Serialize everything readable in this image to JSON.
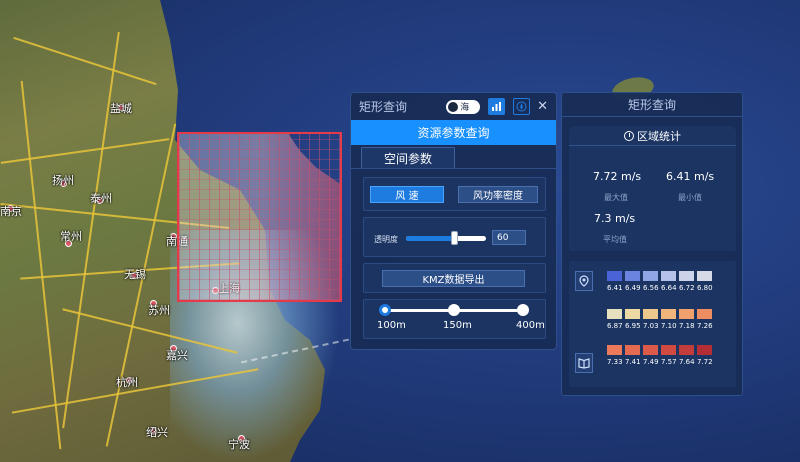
{
  "map": {
    "cities": [
      "南京",
      "南通",
      "上海",
      "杭州",
      "盐城",
      "常州",
      "苏州",
      "嘉兴",
      "绍兴",
      "无锡",
      "泰州",
      "扬州",
      "宁波"
    ]
  },
  "rect_panel": {
    "title": "矩形查询",
    "toggle_label": "海",
    "subtitle": "资源参数查询",
    "tab_label": "空间参数",
    "buttons": {
      "wind_speed": "风 速",
      "power_density": "风功率密度",
      "export": "KMZ数据导出"
    },
    "opacity": {
      "label": "透明度",
      "value": "60",
      "level": 60
    },
    "resolution": {
      "options": [
        "100m",
        "150m",
        "400m"
      ],
      "selected": "100m"
    }
  },
  "stat_panel": {
    "title": "矩形查询",
    "card_title": "区域统计",
    "max_value": "7.72 m/s",
    "max_label": "最大值",
    "min_value": "6.41 m/s",
    "min_label": "最小值",
    "avg_value": "7.3 m/s",
    "avg_label": "平均值"
  },
  "legend": {
    "rows": [
      {
        "colors": [
          "#4a63d6",
          "#6a84e0",
          "#8fa5e6",
          "#b6c1e9",
          "#ccd2e8",
          "#d6d9e6"
        ],
        "labels": [
          "6.41",
          "6.49",
          "6.56",
          "6.64",
          "6.72",
          "6.80"
        ]
      },
      {
        "colors": [
          "#e6e0bf",
          "#ecd9a3",
          "#eec78d",
          "#f0b57a",
          "#f0a06c",
          "#ee8c62"
        ],
        "labels": [
          "6.87",
          "6.95",
          "7.03",
          "7.10",
          "7.18",
          "7.26"
        ]
      },
      {
        "colors": [
          "#ec7a5a",
          "#e56a52",
          "#dc5a4a",
          "#d04a42",
          "#c23c3b",
          "#b42f35"
        ],
        "labels": [
          "7.33",
          "7.41",
          "7.49",
          "7.57",
          "7.64",
          "7.72"
        ]
      }
    ]
  }
}
